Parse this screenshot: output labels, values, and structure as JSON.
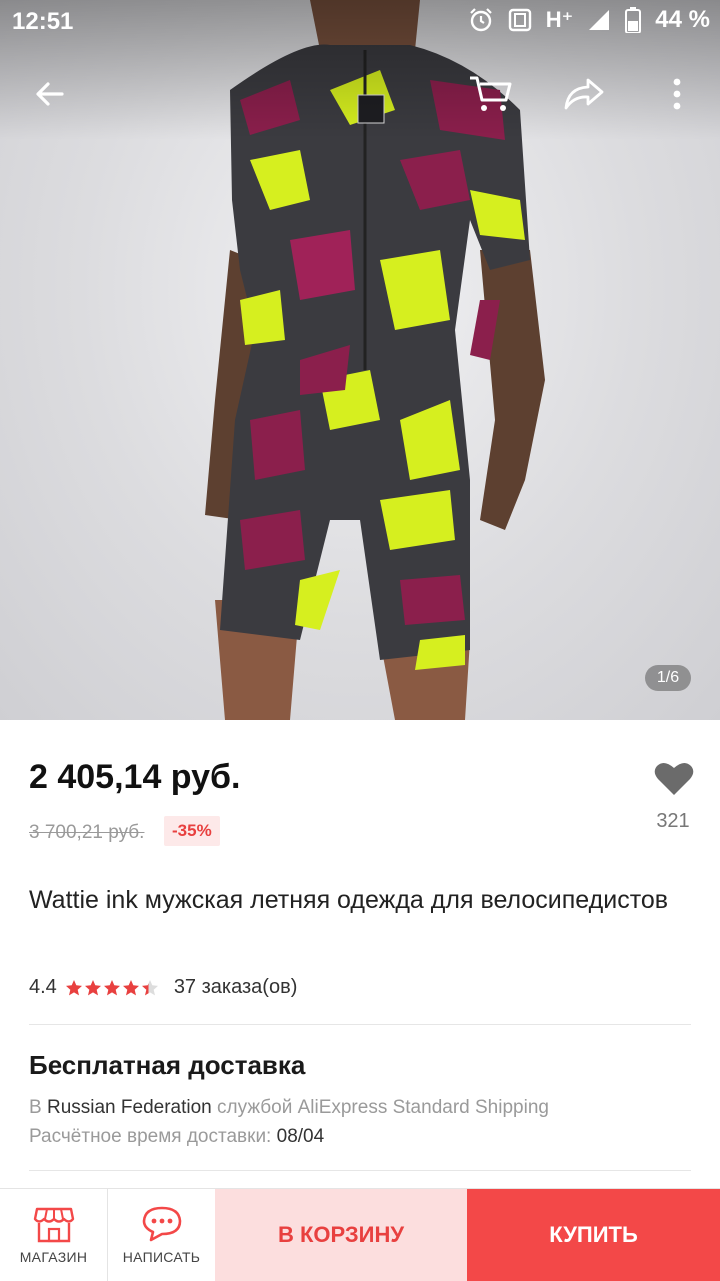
{
  "status_bar": {
    "time": "12:51",
    "network": "H⁺",
    "battery": "44 %"
  },
  "gallery": {
    "counter": "1/6",
    "image_alt": "Cycling skinsuit camouflage",
    "icons": [
      "back-arrow-icon",
      "cart-icon",
      "share-icon",
      "more-vert-icon"
    ]
  },
  "product": {
    "price": "2 405,14 руб.",
    "old_price": "3 700,21 руб.",
    "discount": "-35%",
    "wishlist_count": "321",
    "title": "Wattie ink мужская летняя одежда для велосипедистов",
    "rating": "4.4",
    "rating_value": 4.4,
    "orders": "37 заказа(ов)"
  },
  "shipping": {
    "title": "Бесплатная доставка",
    "prefix": "В",
    "country": "Russian Federation",
    "service": "службой AliExpress Standard Shipping",
    "eta_label": "Расчётное время доставки:",
    "eta_date": "08/04"
  },
  "bottom_bar": {
    "store_label": "МАГАЗИН",
    "message_label": "НАПИСАТЬ",
    "cart_label": "В КОРЗИНУ",
    "buy_label": "КУПИТЬ"
  },
  "colors": {
    "accent": "#f34848",
    "accent_light": "#fcdede",
    "star": "#e8403f"
  }
}
